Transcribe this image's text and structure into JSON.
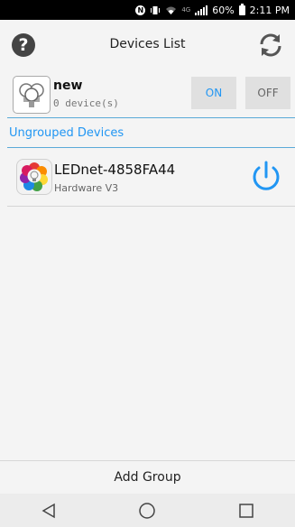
{
  "status_bar": {
    "battery": "60%",
    "time": "2:11 PM",
    "network": "4G"
  },
  "header": {
    "title": "Devices List",
    "help_icon": "question-circle-icon",
    "refresh_icon": "refresh-icon",
    "help_glyph": "?"
  },
  "group": {
    "name": "new",
    "count": "0 device(s)",
    "on_label": "ON",
    "off_label": "OFF",
    "icon": "bulb-group-icon"
  },
  "section": {
    "title": "Ungrouped Devices"
  },
  "devices": [
    {
      "name": "LEDnet-4858FA44",
      "hardware": "Hardware V3",
      "icon": "color-bulb-icon",
      "power_icon": "power-icon"
    }
  ],
  "footer": {
    "add_group_label": "Add Group"
  },
  "colors": {
    "accent": "#2196f3",
    "divider": "#5aaad8"
  }
}
